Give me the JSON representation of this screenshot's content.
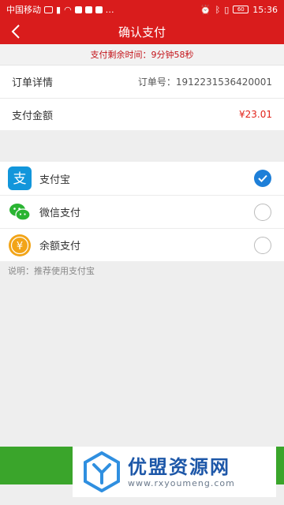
{
  "status_bar": {
    "carrier": "中国移动",
    "battery": "60",
    "time": "15:36"
  },
  "nav": {
    "title": "确认支付"
  },
  "timer": {
    "text": "支付剩余时间：9分钟58秒"
  },
  "order": {
    "detail_label": "订单详情",
    "order_no": "订单号：1912231536420001",
    "amount_label": "支付金额",
    "amount": "¥23.01"
  },
  "payment_methods": [
    {
      "label": "支付宝",
      "selected": true,
      "icon": "alipay-icon"
    },
    {
      "label": "微信支付",
      "selected": false,
      "icon": "wechat-icon"
    },
    {
      "label": "余额支付",
      "selected": false,
      "icon": "balance-icon"
    }
  ],
  "note": {
    "text": "说明：推荐使用支付宝"
  },
  "watermark": {
    "name": "优盟资源网",
    "url": "www.rxyoumeng.com"
  },
  "colors": {
    "header": "#d91c1c",
    "alipay": "#1296db",
    "wechat": "#2ab432",
    "balance": "#f2a417",
    "accent": "#e2231a",
    "button": "#3aa52b"
  }
}
